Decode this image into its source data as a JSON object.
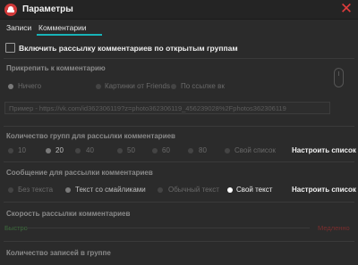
{
  "window": {
    "title": "Параметры",
    "close_icon": "close-icon",
    "accent": "#17b3b8",
    "close_color": "#e03c3c"
  },
  "tabs": [
    {
      "label": "Записи"
    },
    {
      "label": "Комментарии"
    }
  ],
  "enable_mailing": {
    "label": "Включить рассылку комментариев по открытым группам",
    "checked": false
  },
  "attach": {
    "title": "Прикрепить к  комментарию",
    "options": [
      "Ничего",
      "Картинки от Friends",
      "По ссылке вк"
    ],
    "selected": "Ничего",
    "url_placeholder": "Пример - https://vk.com/id362306119?z=photo362306119_456239028%2Fphotos362306119"
  },
  "groups_count": {
    "title": "Количество групп для рассылки комментариев",
    "options": [
      "10",
      "20",
      "40",
      "50",
      "60",
      "80"
    ],
    "selected": "20",
    "own_list": "Свой список",
    "configure_btn": "Настроить список"
  },
  "message": {
    "title": "Сообщение для рассылки комментариев",
    "options": [
      "Без текста",
      "Текст со смайликами",
      "Обычный текст",
      "Свой текст"
    ],
    "selected": "Свой текст",
    "configure_btn": "Настроить список"
  },
  "speed": {
    "title": "Скорость рассылки комментариев",
    "min_label": "Быстро",
    "max_label": "Медленно"
  },
  "posts_in_group": {
    "title": "Количество записей в группе"
  }
}
